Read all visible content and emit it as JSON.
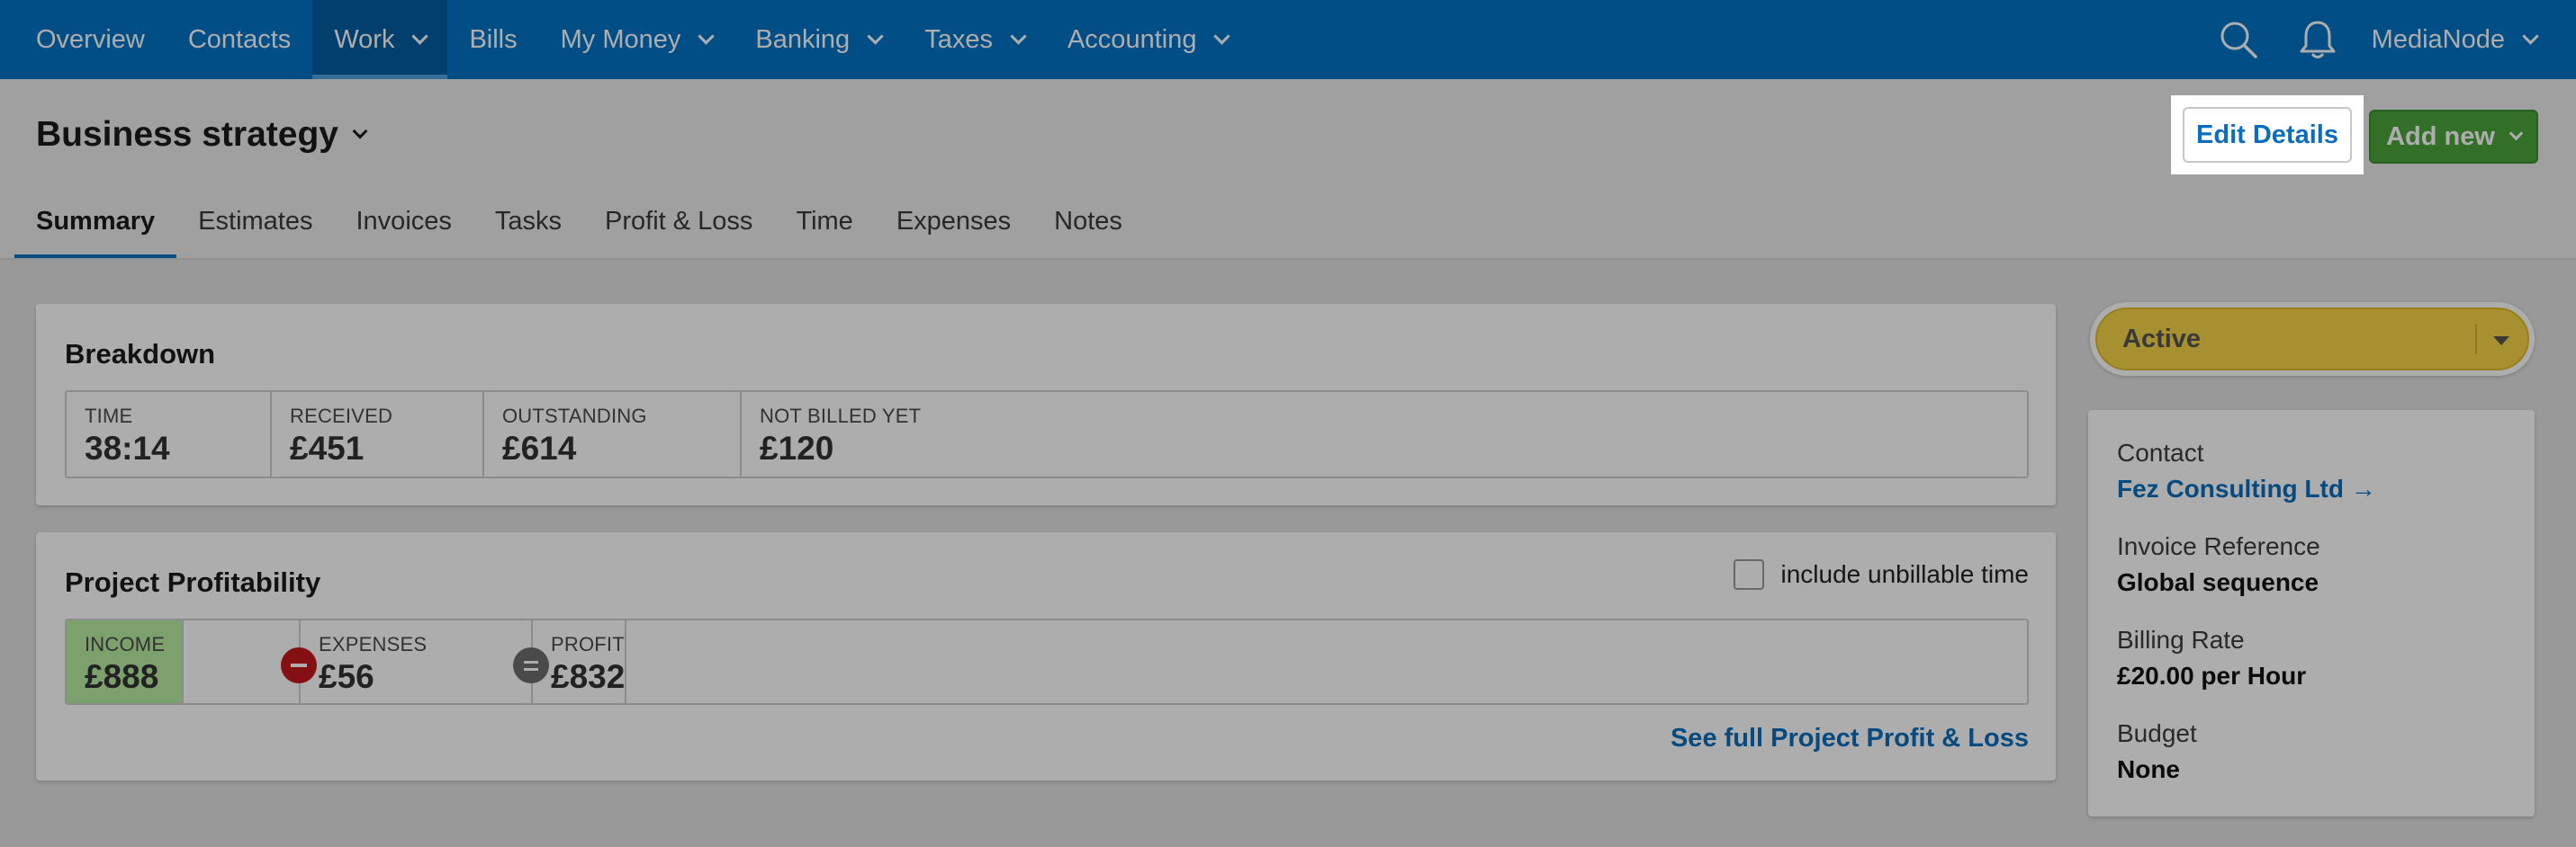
{
  "nav": {
    "items": [
      {
        "label": "Overview",
        "dropdown": false,
        "active": false
      },
      {
        "label": "Contacts",
        "dropdown": false,
        "active": false
      },
      {
        "label": "Work",
        "dropdown": true,
        "active": true
      },
      {
        "label": "Bills",
        "dropdown": false,
        "active": false
      },
      {
        "label": "My Money",
        "dropdown": true,
        "active": false
      },
      {
        "label": "Banking",
        "dropdown": true,
        "active": false
      },
      {
        "label": "Taxes",
        "dropdown": true,
        "active": false
      },
      {
        "label": "Accounting",
        "dropdown": true,
        "active": false
      }
    ],
    "search_icon": "search-icon",
    "bell_icon": "bell-icon",
    "org_name": "MediaNode"
  },
  "header": {
    "title": "Business strategy",
    "edit_label": "Edit Details",
    "add_label": "Add new"
  },
  "tabs": [
    {
      "label": "Summary",
      "active": true
    },
    {
      "label": "Estimates",
      "active": false
    },
    {
      "label": "Invoices",
      "active": false
    },
    {
      "label": "Tasks",
      "active": false
    },
    {
      "label": "Profit & Loss",
      "active": false
    },
    {
      "label": "Time",
      "active": false
    },
    {
      "label": "Expenses",
      "active": false
    },
    {
      "label": "Notes",
      "active": false
    }
  ],
  "breakdown": {
    "title": "Breakdown",
    "stats": [
      {
        "label": "TIME",
        "value": "38:14"
      },
      {
        "label": "RECEIVED",
        "value": "£451"
      },
      {
        "label": "OUTSTANDING",
        "value": "£614"
      },
      {
        "label": "NOT BILLED YET",
        "value": "£120"
      }
    ]
  },
  "profitability": {
    "title": "Project Profitability",
    "checkbox_label": "include unbillable time",
    "checkbox_checked": false,
    "income": {
      "label": "INCOME",
      "value": "£888"
    },
    "expenses": {
      "label": "EXPENSES",
      "value": "£56"
    },
    "profit": {
      "label": "PROFIT",
      "value": "£832"
    },
    "full_link": "See full Project Profit & Loss"
  },
  "sidebar": {
    "status": "Active",
    "details": [
      {
        "label": "Contact",
        "value": "Fez Consulting Ltd →",
        "link": true
      },
      {
        "label": "Invoice Reference",
        "value": "Global sequence",
        "link": false
      },
      {
        "label": "Billing Rate",
        "value": "£20.00 per Hour",
        "link": false
      },
      {
        "label": "Budget",
        "value": "None",
        "link": false
      }
    ]
  },
  "colors": {
    "nav_bg": "#0073c4",
    "add_button": "#4aa63c",
    "status_yellow": "#f7d447",
    "income_bg": "#b9eea0",
    "link_blue": "#0a6dbd"
  }
}
